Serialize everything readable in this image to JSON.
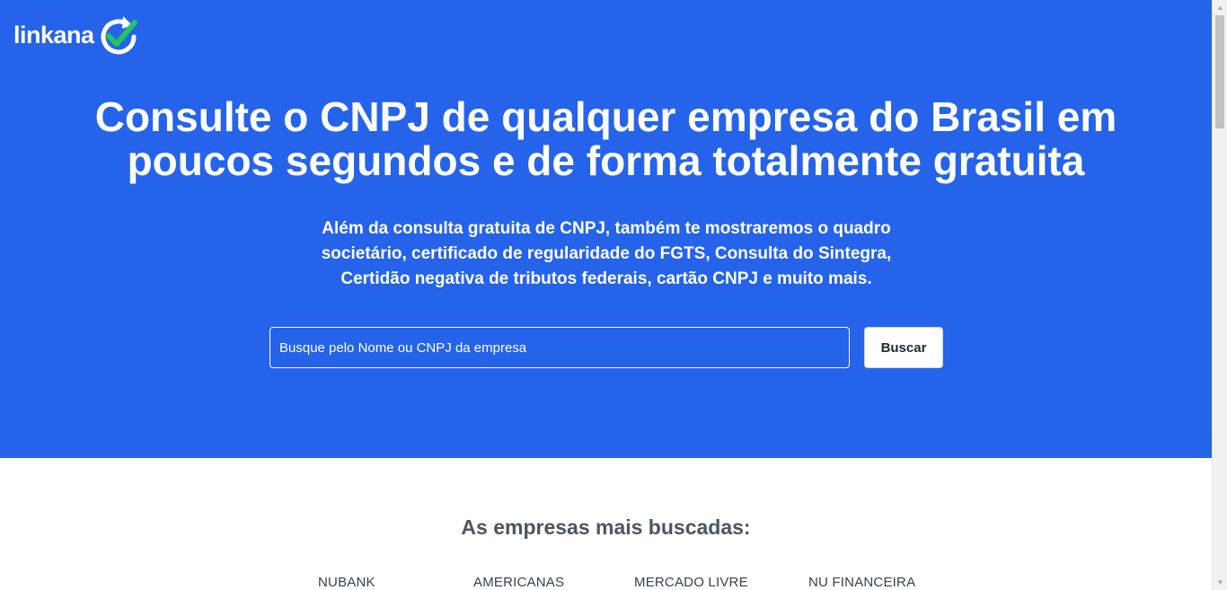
{
  "brand": {
    "name": "linkana",
    "primary_color": "#2563eb",
    "check_color": "#22c55e",
    "logo_icon": "circular-arrow-check-icon"
  },
  "hero": {
    "title_line1": "Consulte o CNPJ de qualquer empresa do Brasil em",
    "title_line2": "poucos segundos e de forma totalmente gratuita",
    "subtitle_line1": "Além da consulta gratuita de CNPJ, também te mostraremos o quadro",
    "subtitle_line2": "societário, certificado de regularidade do FGTS, Consulta do Sintegra,",
    "subtitle_line3": "Certidão negativa de tributos federais, cartão CNPJ e muito mais."
  },
  "search": {
    "placeholder": "Busque pelo Nome ou CNPJ da empresa",
    "value": "",
    "button_label": "Buscar"
  },
  "popular": {
    "title": "As empresas mais buscadas:",
    "companies": [
      "NUBANK",
      "AMERICANAS",
      "MERCADO LIVRE",
      "NU FINANCEIRA"
    ]
  },
  "scrollbar": {
    "up_icon": "scroll-up-arrow-icon",
    "down_icon": "scroll-down-arrow-icon"
  }
}
